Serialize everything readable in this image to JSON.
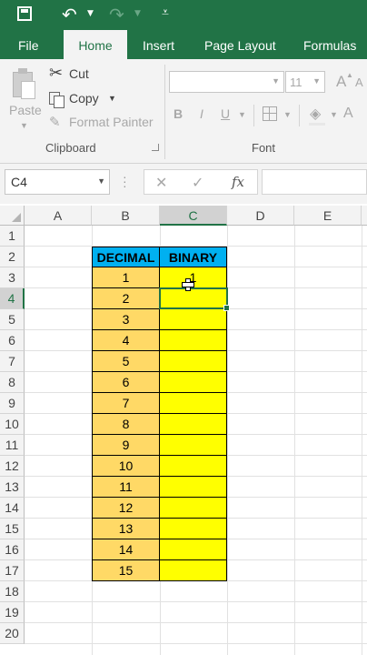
{
  "colors": {
    "excel_green": "#217346",
    "header_fill": "#00b0f0",
    "decimal_fill": "#ffd966",
    "binary_fill": "#ffff00"
  },
  "qat": {
    "save_icon": "save-icon",
    "undo_icon": "undo-icon",
    "redo_icon": "redo-icon",
    "customize_icon": "customize-icon"
  },
  "tabs": [
    {
      "label": "File"
    },
    {
      "label": "Home"
    },
    {
      "label": "Insert"
    },
    {
      "label": "Page Layout"
    },
    {
      "label": "Formulas"
    }
  ],
  "ribbon": {
    "paste": "Paste",
    "cut": "Cut",
    "copy": "Copy",
    "format_painter": "Format Painter",
    "clipboard": "Clipboard",
    "font_size": "11",
    "font_group": "Font",
    "grow_font": "A",
    "shrink_font": "A",
    "bold": "B",
    "italic": "I",
    "underline": "U"
  },
  "formula_bar": {
    "name_box": "C4",
    "cancel": "✕",
    "enter": "✓",
    "fx": "fx",
    "content": ""
  },
  "grid": {
    "columns": [
      "A",
      "B",
      "C",
      "D",
      "E"
    ],
    "rows": [
      "1",
      "2",
      "3",
      "4",
      "5",
      "6",
      "7",
      "8",
      "9",
      "10",
      "11",
      "12",
      "13",
      "14",
      "15",
      "16",
      "17",
      "18",
      "19",
      "20"
    ],
    "header": [
      "DECIMAL",
      "BINARY"
    ],
    "decimal": [
      "1",
      "2",
      "3",
      "4",
      "5",
      "6",
      "7",
      "8",
      "9",
      "10",
      "11",
      "12",
      "13",
      "14",
      "15"
    ],
    "binary": [
      "1",
      "",
      "",
      "",
      "",
      "",
      "",
      "",
      "",
      "",
      "",
      "",
      "",
      "",
      ""
    ]
  }
}
